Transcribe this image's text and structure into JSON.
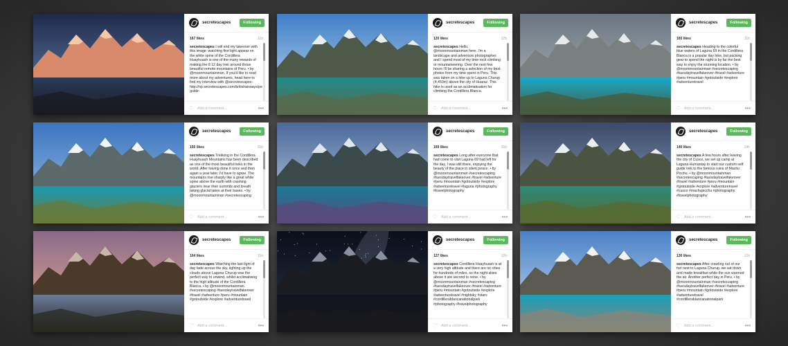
{
  "posts": [
    {
      "user": "secretescapes",
      "follow": "Following",
      "likes": "167 likes",
      "time": "11h",
      "caption_user": "secretescapes",
      "caption": "I will end my takeover with this image: watching first light appear on the white spine of the Cordillera Huayhuash is one of the many rewards of making the 8 12 day trek around those beautiful remote mountains of Peru. • by @moonmountainman. If you'd like to read more about my adventures, head here to find my interview with @secretescapes: http://np.secretescapes.com/britishairways/peru-guide-",
      "comment": "Add a comment...",
      "more": "•••"
    },
    {
      "user": "secretescapes",
      "follow": "Following",
      "likes": "120 likes",
      "time": "12h",
      "caption_user": "secretescapes",
      "caption": "Hello, @moonmountainman here. I'm a landscape and adventure photographer and I spend most of my time rock climbing or mountaineering. Over the next few hours I'll be sharing a selection of my best photos from my time spent in Peru. This was taken on a hike up to Laguna Churup (4,450m) above the city of Huaraz. This hike is used as an acclimatisation for climbing the Cordillera Blanca.",
      "comment": "Add a comment...",
      "more": "•••"
    },
    {
      "user": "secretescapes",
      "follow": "Following",
      "likes": "165 likes",
      "time": "11h",
      "caption_user": "secretescapes",
      "caption": "Heading to the colorful blue waters of Laguna 69 in the Cordillera Blanca is a popular day hike, but packing gear to spend the night is by far the best way to enjoy the stunning location. • by @moonmountainman #secretescaping #tuesdaytravelfakeover #travel #adventure #peru #mountain #gotoutside #explore #adventuretravel",
      "comment": "Add a comment...",
      "more": "•••"
    },
    {
      "user": "secretescapes",
      "follow": "Following",
      "likes": "150 likes",
      "time": "15h",
      "caption_user": "secretescapes",
      "caption": "Trekking in the Cordillera Huayhuash Mountains has been described as one of the most beautiful treks in the world. After having done it once and then again a year later, I'd have to agree. The mountains rise sharply like a great white spine above the earth with crashing glaciers near their summits and breath taking glacial lakes at their bases. • by @moonmountainman #secretescaping",
      "comment": "Add a comment...",
      "more": "•••"
    },
    {
      "user": "secretescapes",
      "follow": "Following",
      "likes": "169 likes",
      "time": "15h",
      "caption_user": "secretescapes",
      "caption": "Long after everyone that had come to visit Laguna 69 had left for the day, I was still there, enjoying the beauty of the place in silent peace. • by @moonmountainman #secretescaping #tuesdaytravelfakeover #travel #adventure #peru #mountain #gotoutside #explore #adventuretravel #laguna #photography #travelphotography",
      "comment": "Add a comment...",
      "more": "•••"
    },
    {
      "user": "secretescapes",
      "follow": "Following",
      "likes": "140 likes",
      "time": "14h",
      "caption_user": "secretescapes",
      "caption": "A few hours after leaving the city of Cusco, we set up camp at Laguna Humantay to start our custom self guide trek to the famous ruins of Machu Picchu. • by @moonmountainman #secretescaping #tuesdaytravelfakeover #travel #adventure #peru #mountain #gotoutside #explore #adventuretravel #cusco #machupicchu #photography #travelphotography",
      "comment": "Add a comment...",
      "more": "•••"
    },
    {
      "user": "secretescapes",
      "follow": "Following",
      "likes": "104 likes",
      "time": "11h",
      "caption_user": "secretescapes",
      "caption": "Watching the last light of day fade across the sky, lighting up the clouds above Laguna Churup was the perfect way to unwind, whilst acclimatising to the high altitude of the Cordillera Blanca. • by @moonmountainman #secretescaping #tuesdaytravelfakeover #travel #adventure #peru #mountain #gotoutside #explore #adventuretravel",
      "comment": "Add a comment...",
      "more": "•••"
    },
    {
      "user": "secretescapes",
      "follow": "Following",
      "likes": "127 likes",
      "time": "12h",
      "caption_user": "secretescapes",
      "caption": "Cordillera Huayhuash is at a very high altitude and there are no cities for hundreds of miles, so the night skies above it are second to none. • by @moonmountainman #secretescaping #tuesdaytravelfakeover #travel #adventure #peru #mountain #gotoutside #explore #adventuretravel #nightsky #stars #cordillerablancanationalpark #photography #travelphotography",
      "comment": "Add a comment...",
      "more": "•••"
    },
    {
      "user": "secretescapes",
      "follow": "Following",
      "likes": "130 likes",
      "time": "12h",
      "caption_user": "secretescapes",
      "caption": "After crawling out of our fort next to Laguna Churup, we sat down and made breakfast while the sun warmed the air. Another perfect day in Peru. • by @moonmountainman #secretescaping #tuesdaytravelfakeover #travel #adventure #peru #mountain #gotoutside #explore #adventuretravel #cordillerablancanationalpark",
      "comment": "Add a comment...",
      "more": "•••"
    }
  ],
  "photos": [
    {
      "sky1": "#1f2a4a",
      "sky2": "#6a8ab8",
      "mtn": "#d98a6a",
      "snow": "#f4c9a8",
      "water": "#2a3a5a",
      "ground": "#1a1a22"
    },
    {
      "sky1": "#3f7fc8",
      "sky2": "#cfe0f0",
      "mtn": "#4d5a4a",
      "snow": "#e8eef0",
      "water": "#1f8a8a",
      "ground": "#5a6a4a"
    },
    {
      "sky1": "#6a7580",
      "sky2": "#b8c0c4",
      "mtn": "#7a8080",
      "snow": "#e6eaec",
      "water": "#18a8c8",
      "ground": "#4a5a3a"
    },
    {
      "sky1": "#3a74c0",
      "sky2": "#a8c8e8",
      "mtn": "#5a6a6a",
      "snow": "#f2f4f6",
      "water": "#1a9ab0",
      "ground": "#6a7a3a"
    },
    {
      "sky1": "#4a6a9a",
      "sky2": "#c8d8e8",
      "mtn": "#3a4a4a",
      "snow": "#e0e8ee",
      "water": "#1a7a9a",
      "ground": "#5a4a7a"
    },
    {
      "sky1": "#3a4a6a",
      "sky2": "#9ab0c8",
      "mtn": "#4a5440",
      "snow": "#eaeef0",
      "water": "#2a8a7a",
      "ground": "#5a6a30"
    },
    {
      "sky1": "#8a6a8a",
      "sky2": "#f0b090",
      "mtn": "#4a3a2a",
      "snow": "#c8b8a8",
      "water": "#6a7a9a",
      "ground": "#2a2a22"
    },
    {
      "sky1": "#0a0e18",
      "sky2": "#2a3448",
      "mtn": "#1a1c22",
      "snow": "#8a90a0",
      "water": "#10141c",
      "ground": "#1a1a1e"
    },
    {
      "sky1": "#4a82c8",
      "sky2": "#d0e0f0",
      "mtn": "#5a5a50",
      "snow": "#f0f2f4",
      "water": "#18a0b8",
      "ground": "#8a8478"
    }
  ]
}
